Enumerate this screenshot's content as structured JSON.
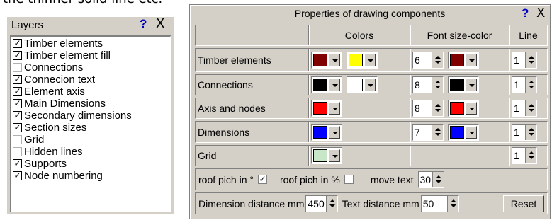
{
  "top_text": "the thinner solid line etc.",
  "layers_panel": {
    "title": "Layers",
    "help": "?",
    "close": "X",
    "items": [
      {
        "label": "Timber elements",
        "checked": true
      },
      {
        "label": "Timber element fill",
        "checked": true
      },
      {
        "label": "Connections",
        "checked": false
      },
      {
        "label": "Connecion text",
        "checked": true
      },
      {
        "label": "Element axis",
        "checked": true
      },
      {
        "label": "Main Dimensions",
        "checked": true
      },
      {
        "label": "Secondary dimensions",
        "checked": true
      },
      {
        "label": "Section sizes",
        "checked": true
      },
      {
        "label": "Grid",
        "checked": false
      },
      {
        "label": "Hidden lines",
        "checked": false
      },
      {
        "label": "Supports",
        "checked": true
      },
      {
        "label": "Node  numbering",
        "checked": true
      }
    ]
  },
  "properties_panel": {
    "title": "Properties of drawing components",
    "help": "?",
    "close": "X",
    "headers": {
      "colors": "Colors",
      "font": "Font size-color",
      "line": "Line"
    },
    "rows": [
      {
        "label": "Timber elements",
        "color1": "#800000",
        "color2": "#ffff00",
        "font_size": "6",
        "font_color": "#800000",
        "line": "1"
      },
      {
        "label": "Connections",
        "color1": "#000000",
        "color2": "#ffffff",
        "font_size": "8",
        "font_color": "#000000",
        "line": "1"
      },
      {
        "label": "Axis and nodes",
        "color1": "#ff0000",
        "font_size": "8",
        "font_color": "#ff0000",
        "line": "1"
      },
      {
        "label": "Dimensions",
        "color1": "#0000ff",
        "font_size": "7",
        "font_color": "#0000ff",
        "line": "1"
      },
      {
        "label": "Grid",
        "color1": "#c8e6c8",
        "line": "1"
      }
    ],
    "roof_pitch_deg_label": "roof pich in °",
    "roof_pitch_deg_checked": true,
    "roof_pitch_pct_label": "roof pich in %",
    "roof_pitch_pct_checked": false,
    "move_text_label": "move text",
    "move_text_value": "30",
    "dimension_distance_label": "Dimension distance mm",
    "dimension_distance_value": "450",
    "text_distance_label": "Text distance mm",
    "text_distance_value": "50",
    "reset_label": "Reset"
  }
}
